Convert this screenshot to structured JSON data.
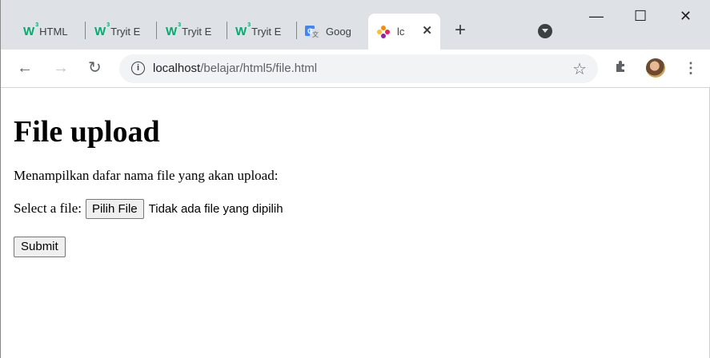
{
  "browser": {
    "tabs": [
      {
        "label": "HTML",
        "favicon": "w3schools-icon"
      },
      {
        "label": "Tryit E",
        "favicon": "w3schools-icon"
      },
      {
        "label": "Tryit E",
        "favicon": "w3schools-icon"
      },
      {
        "label": "Tryit E",
        "favicon": "w3schools-icon"
      },
      {
        "label": "Goog",
        "favicon": "google-translate-icon"
      },
      {
        "label": "lc",
        "favicon": "xampp-icon",
        "active": true
      }
    ],
    "new_tab_label": "+",
    "window_controls": {
      "minimize": "—",
      "maximize": "☐",
      "close": "✕"
    },
    "url_host": "localhost",
    "url_path": "/belajar/html5/file.html",
    "colors": {
      "tab_strip": "#dee1e6",
      "w3_green": "#04aa6d"
    }
  },
  "page": {
    "title": "File upload",
    "description": "Menampilkan dafar nama file yang akan upload:",
    "file_label": "Select a file:",
    "file_button": "Pilih File",
    "no_file_text": "Tidak ada file yang dipilih",
    "submit_label": "Submit"
  }
}
